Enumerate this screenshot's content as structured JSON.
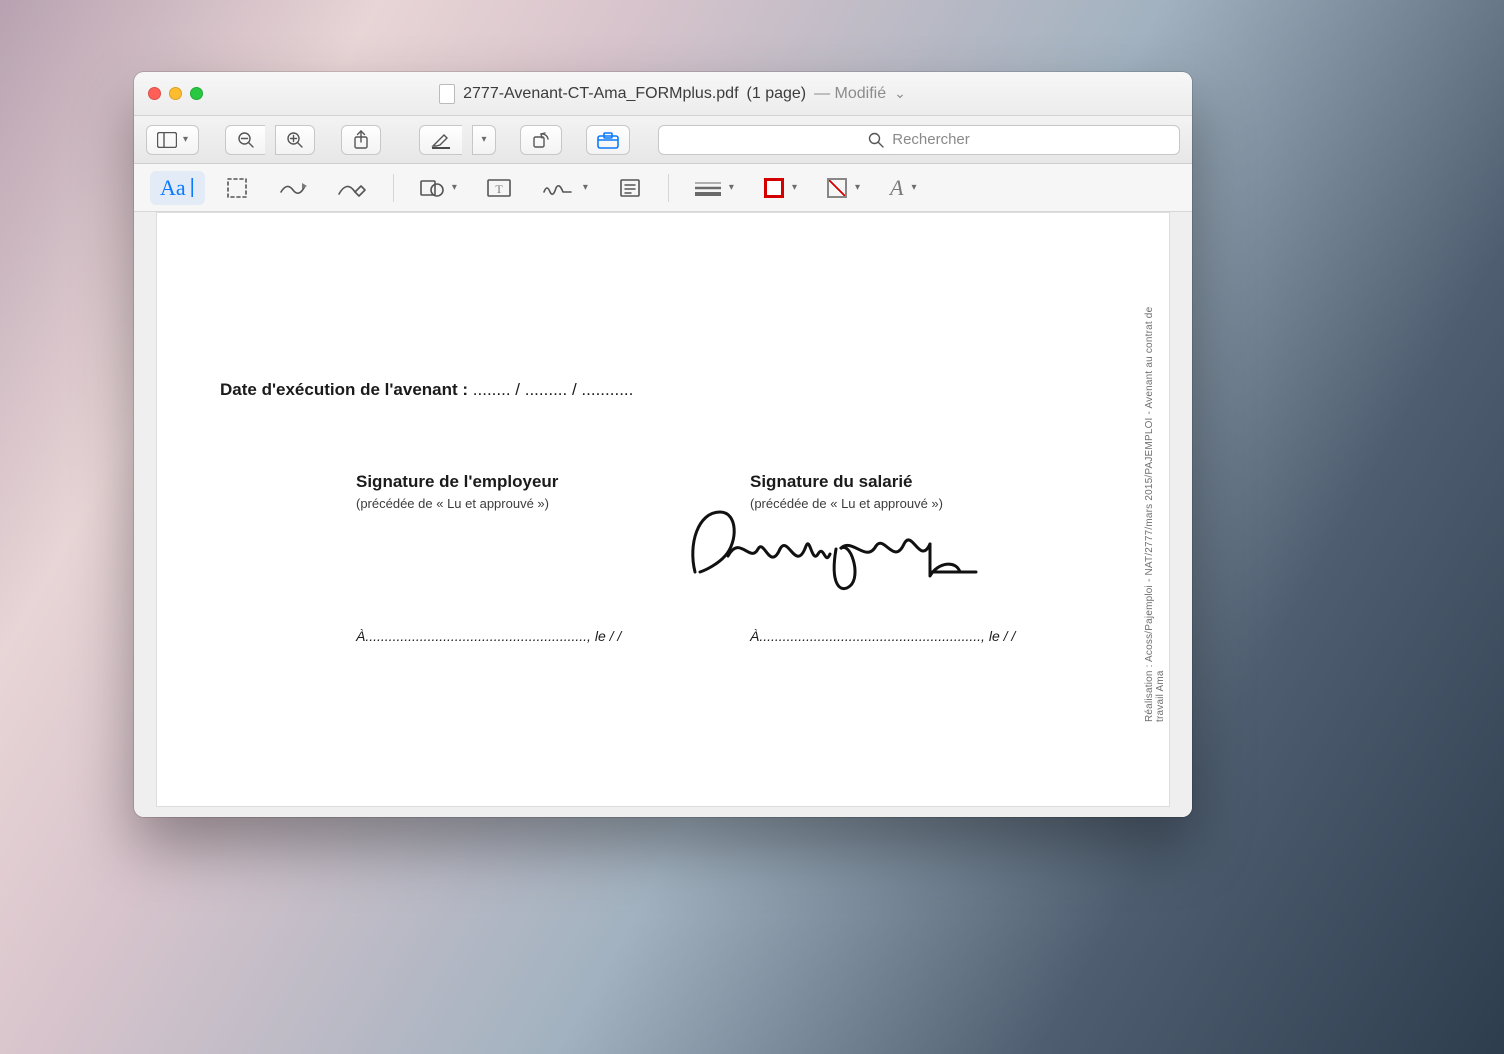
{
  "titlebar": {
    "filename": "2777-Avenant-CT-Ama_FORMplus.pdf",
    "pages_suffix": "(1 page)",
    "modified_label": "— Modifié"
  },
  "toolbar": {
    "search_placeholder": "Rechercher"
  },
  "document": {
    "date_label_bold": "Date d'exécution de l'avenant :",
    "date_dots": " ........ / ......... / ...........",
    "employer_title": "Signature de l'employeur",
    "employer_sub": "(précédée de « Lu et approuvé »)",
    "employee_title": "Signature du salarié",
    "employee_sub": "(précédée de « Lu et approuvé »)",
    "a_line": "À........................................................., le        /      /",
    "sidebar_text": "Réalisation : Acoss/Pajemploi - NAT/2777/mars 2015/PAJEMPLOI - Avenant au contrat de travail Ama",
    "signature_text": "Papergeek"
  },
  "colors": {
    "accent": "#0a7aff",
    "border_swatch": "#d40000"
  }
}
